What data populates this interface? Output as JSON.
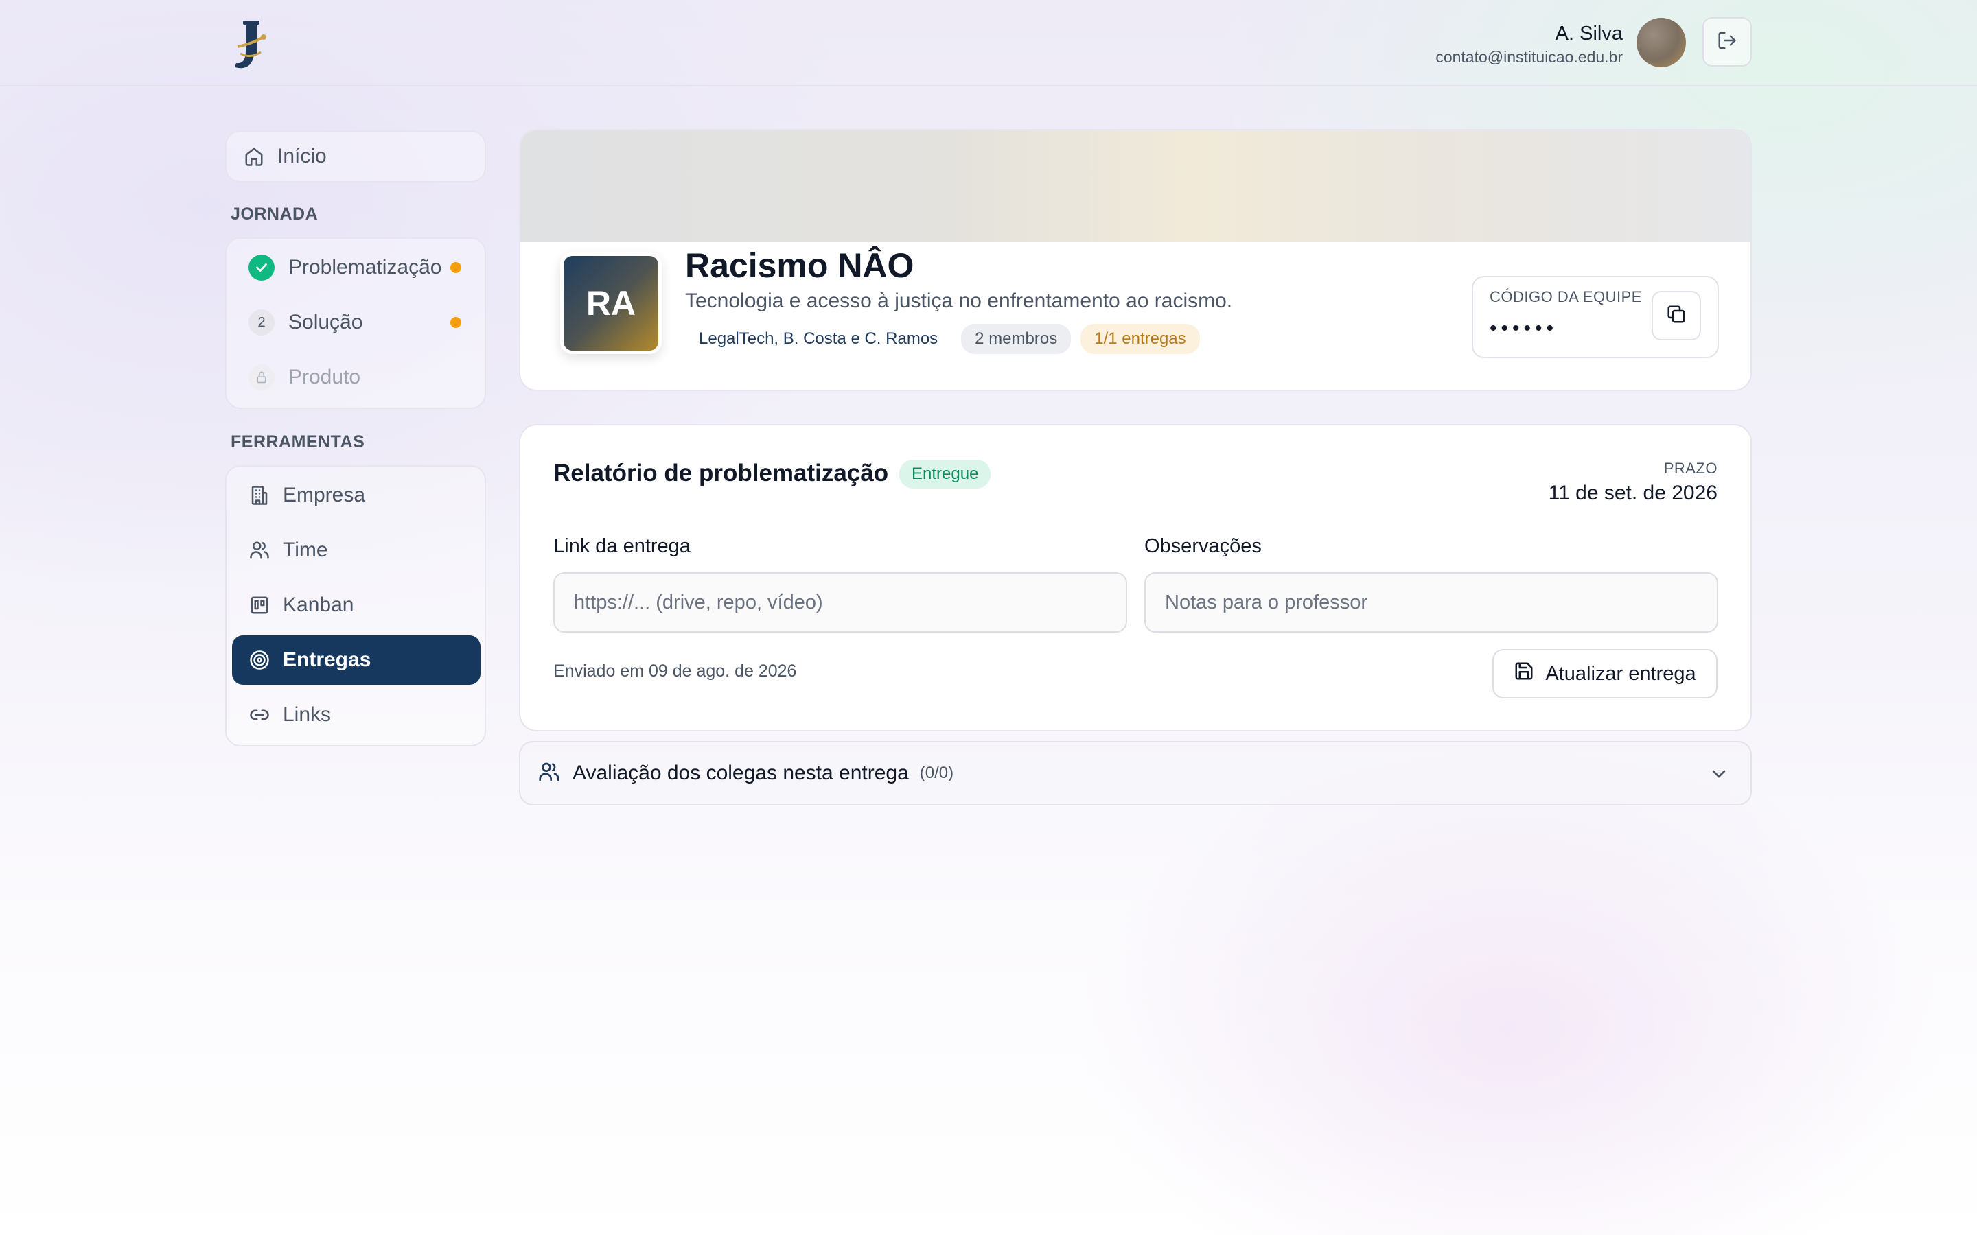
{
  "header": {
    "user_name": "A. Silva",
    "user_email": "contato@instituicao.edu.br"
  },
  "sidebar": {
    "home_label": "Início",
    "journey_title": "JORNADA",
    "journey_steps": [
      {
        "label": "Problematização",
        "badge": "✓",
        "state": "done",
        "pending_dot": true
      },
      {
        "label": "Solução",
        "badge": "2",
        "state": "available",
        "pending_dot": true
      },
      {
        "label": "Produto",
        "badge": "",
        "state": "locked",
        "pending_dot": false
      }
    ],
    "tools_title": "FERRAMENTAS",
    "tools": [
      {
        "label": "Empresa",
        "icon": "building-icon"
      },
      {
        "label": "Time",
        "icon": "users-icon"
      },
      {
        "label": "Kanban",
        "icon": "kanban-icon"
      },
      {
        "label": "Entregas",
        "icon": "target-icon",
        "active": true
      },
      {
        "label": "Links",
        "icon": "link-icon"
      }
    ]
  },
  "team": {
    "initials": "RA",
    "name": "Racismo NÂO",
    "description": "Tecnologia e acesso à justiça no enfrentamento ao racismo.",
    "tags": {
      "members_names": "LegalTech, B. Costa e C. Ramos",
      "members_count": "2 membros",
      "deliveries": "1/1 entregas"
    },
    "code_label": "CÓDIGO DA EQUIPE",
    "code_value": "••••••"
  },
  "delivery": {
    "title": "Relatório de problematização",
    "status": "Entregue",
    "deadline_label": "PRAZO",
    "deadline_value": "11 de set. de 2026",
    "link_label": "Link da entrega",
    "link_placeholder": "https://... (drive, repo, vídeo)",
    "notes_label": "Observações",
    "notes_placeholder": "Notas para o professor",
    "sent_text": "Enviado em 09 de ago. de 2026",
    "update_button": "Atualizar entrega"
  },
  "peer_review": {
    "title": "Avaliação dos colegas nesta entrega",
    "count": "(0/0)"
  },
  "colors": {
    "active_nav": "#16385f",
    "success": "#10b981",
    "pending_dot": "#f59e0b",
    "status_green": "#0f8a5f"
  }
}
